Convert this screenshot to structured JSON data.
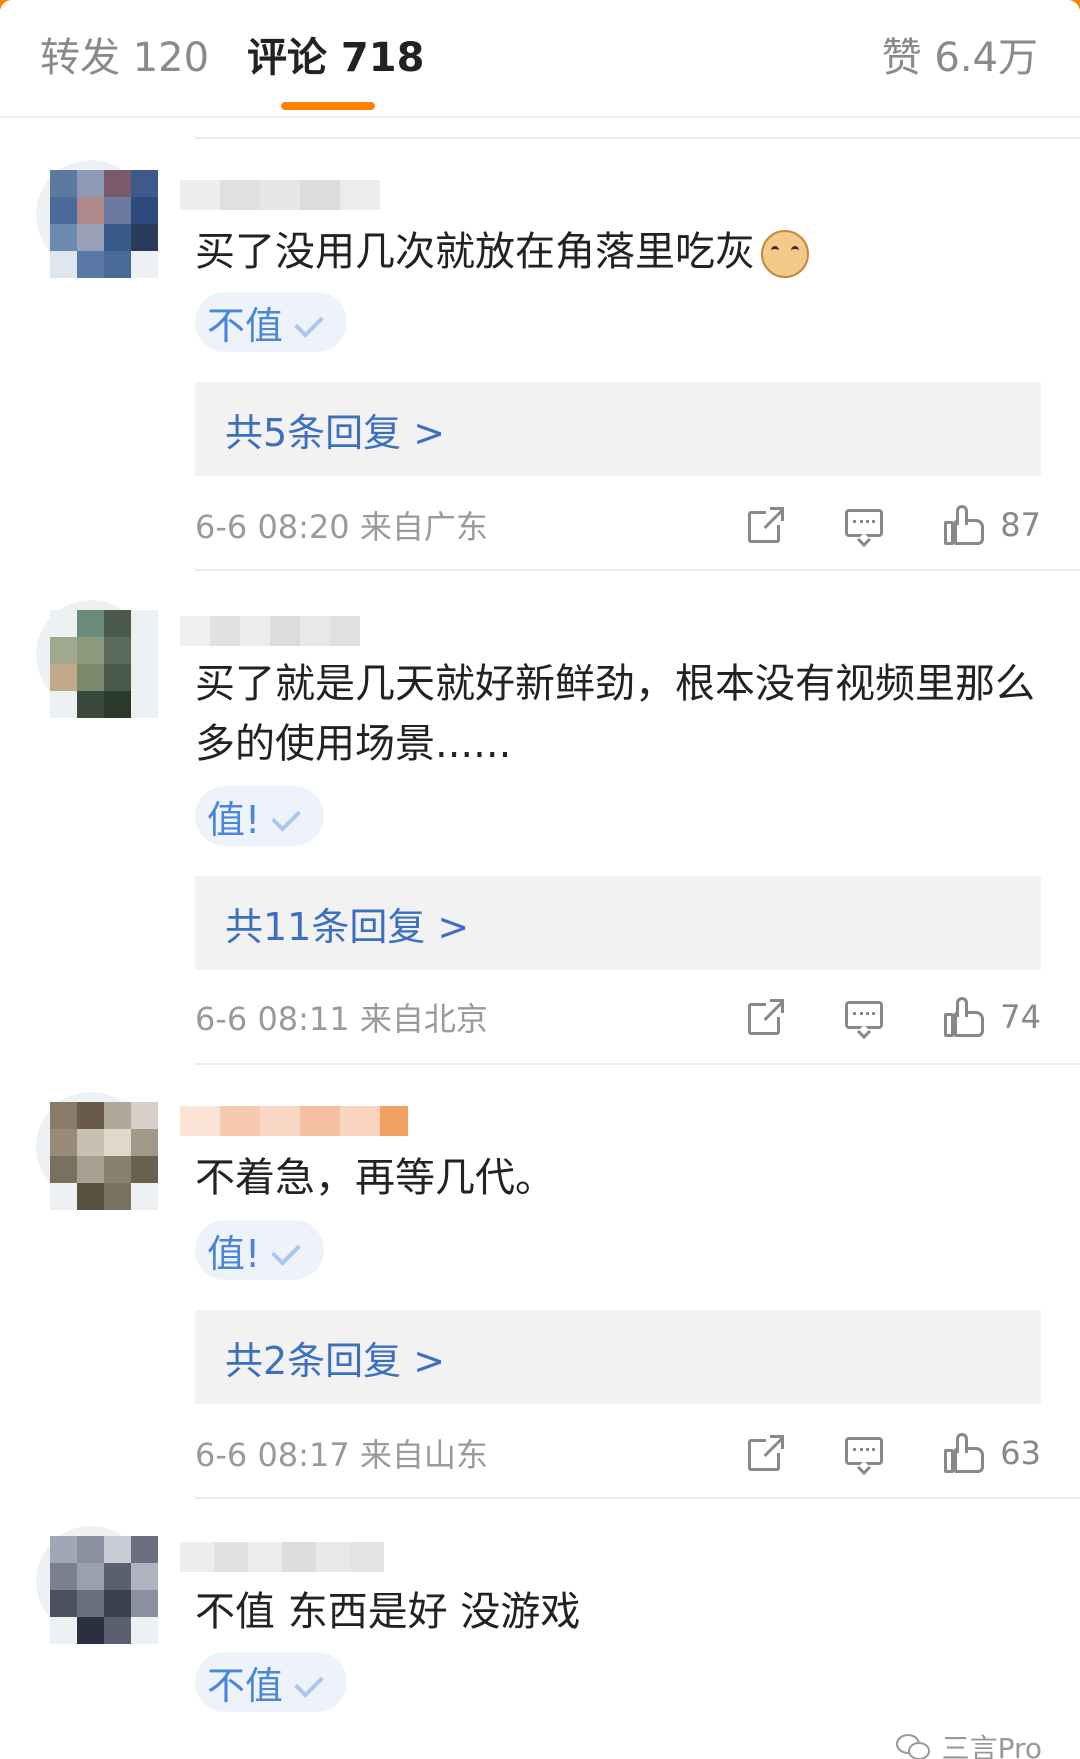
{
  "header": {
    "tab_repost": "转发 120",
    "tab_comments": "评论 718",
    "tab_likes": "赞 6.4万",
    "accent": "#ff8200"
  },
  "comments": [
    {
      "text": "买了没用几次就放在角落里吃灰",
      "emoji": "cat-face-emoji",
      "verdict": "不值",
      "replies": "共5条回复 >",
      "time": "6-6 08:20  来自广东",
      "likes": "87"
    },
    {
      "text": "买了就是几天就好新鲜劲，根本没有视频里那么多的使用场景......",
      "verdict": "值!",
      "replies": "共11条回复 >",
      "time": "6-6 08:11  来自北京",
      "likes": "74"
    },
    {
      "text": "不着急，再等几代。",
      "verdict": "值!",
      "replies": "共2条回复 >",
      "time": "6-6 08:17  来自山东",
      "likes": "63"
    },
    {
      "text": "不值 东西是好 没游戏",
      "verdict": "不值"
    }
  ],
  "watermark": "三言Pro",
  "colors": {
    "link_blue": "#3b6fbf",
    "verdict_blue": "#4a86d8",
    "muted": "#9a9a9a"
  }
}
